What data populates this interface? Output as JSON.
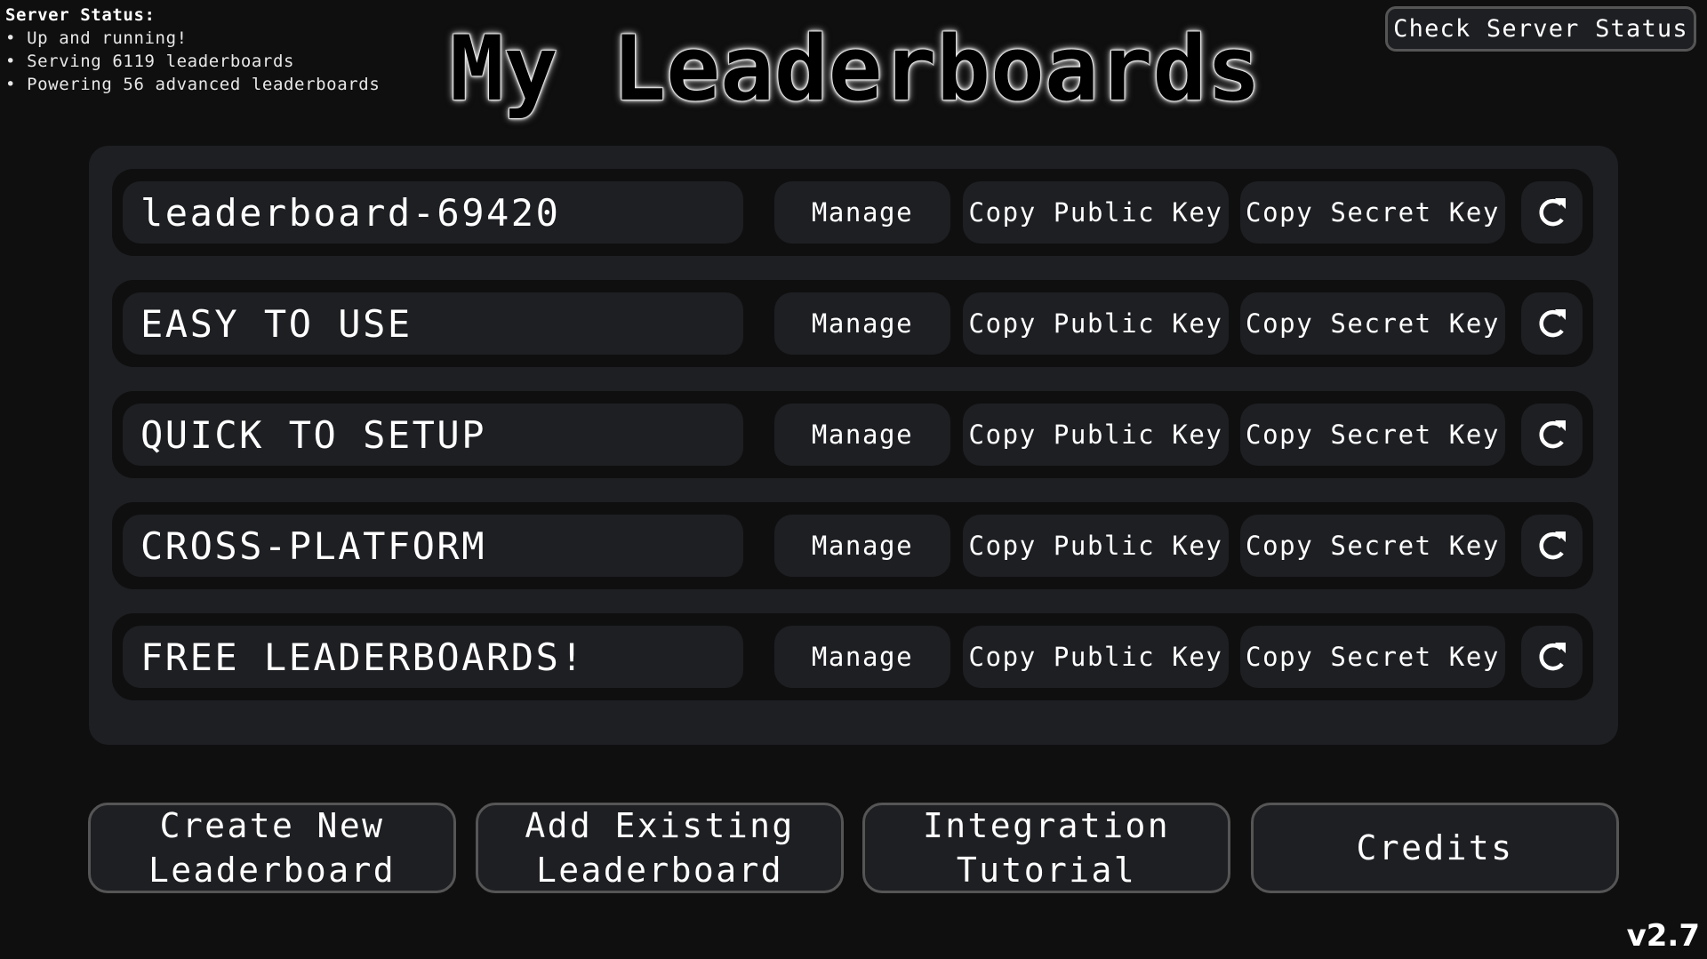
{
  "server_status": {
    "title": "Server Status:",
    "lines": [
      "• Up and running!",
      "• Serving 6119 leaderboards",
      "• Powering 56 advanced leaderboards"
    ]
  },
  "header": {
    "title": "My Leaderboards",
    "check_status_label": "Check Server Status"
  },
  "leaderboards": [
    {
      "name": "leaderboard-69420",
      "manage": "Manage",
      "copy_public": "Copy Public Key",
      "copy_secret": "Copy Secret Key",
      "refresh_icon": "refresh-icon"
    },
    {
      "name": "EASY TO USE",
      "manage": "Manage",
      "copy_public": "Copy Public Key",
      "copy_secret": "Copy Secret Key",
      "refresh_icon": "refresh-icon"
    },
    {
      "name": "QUICK TO SETUP",
      "manage": "Manage",
      "copy_public": "Copy Public Key",
      "copy_secret": "Copy Secret Key",
      "refresh_icon": "refresh-icon"
    },
    {
      "name": "CROSS-PLATFORM",
      "manage": "Manage",
      "copy_public": "Copy Public Key",
      "copy_secret": "Copy Secret Key",
      "refresh_icon": "refresh-icon"
    },
    {
      "name": "FREE LEADERBOARDS!",
      "manage": "Manage",
      "copy_public": "Copy Public Key",
      "copy_secret": "Copy Secret Key",
      "refresh_icon": "refresh-icon"
    }
  ],
  "bottom_buttons": {
    "create_new": [
      "Create New",
      "Leaderboard"
    ],
    "add_existing": [
      "Add Existing",
      "Leaderboard"
    ],
    "integration_tutorial": [
      "Integration",
      "Tutorial"
    ],
    "credits": [
      "Credits"
    ]
  },
  "version": "v2.7",
  "colors": {
    "background": "#0f0f0f",
    "panel": "#1e1f23",
    "border": "#555555",
    "text": "#ffffff"
  }
}
